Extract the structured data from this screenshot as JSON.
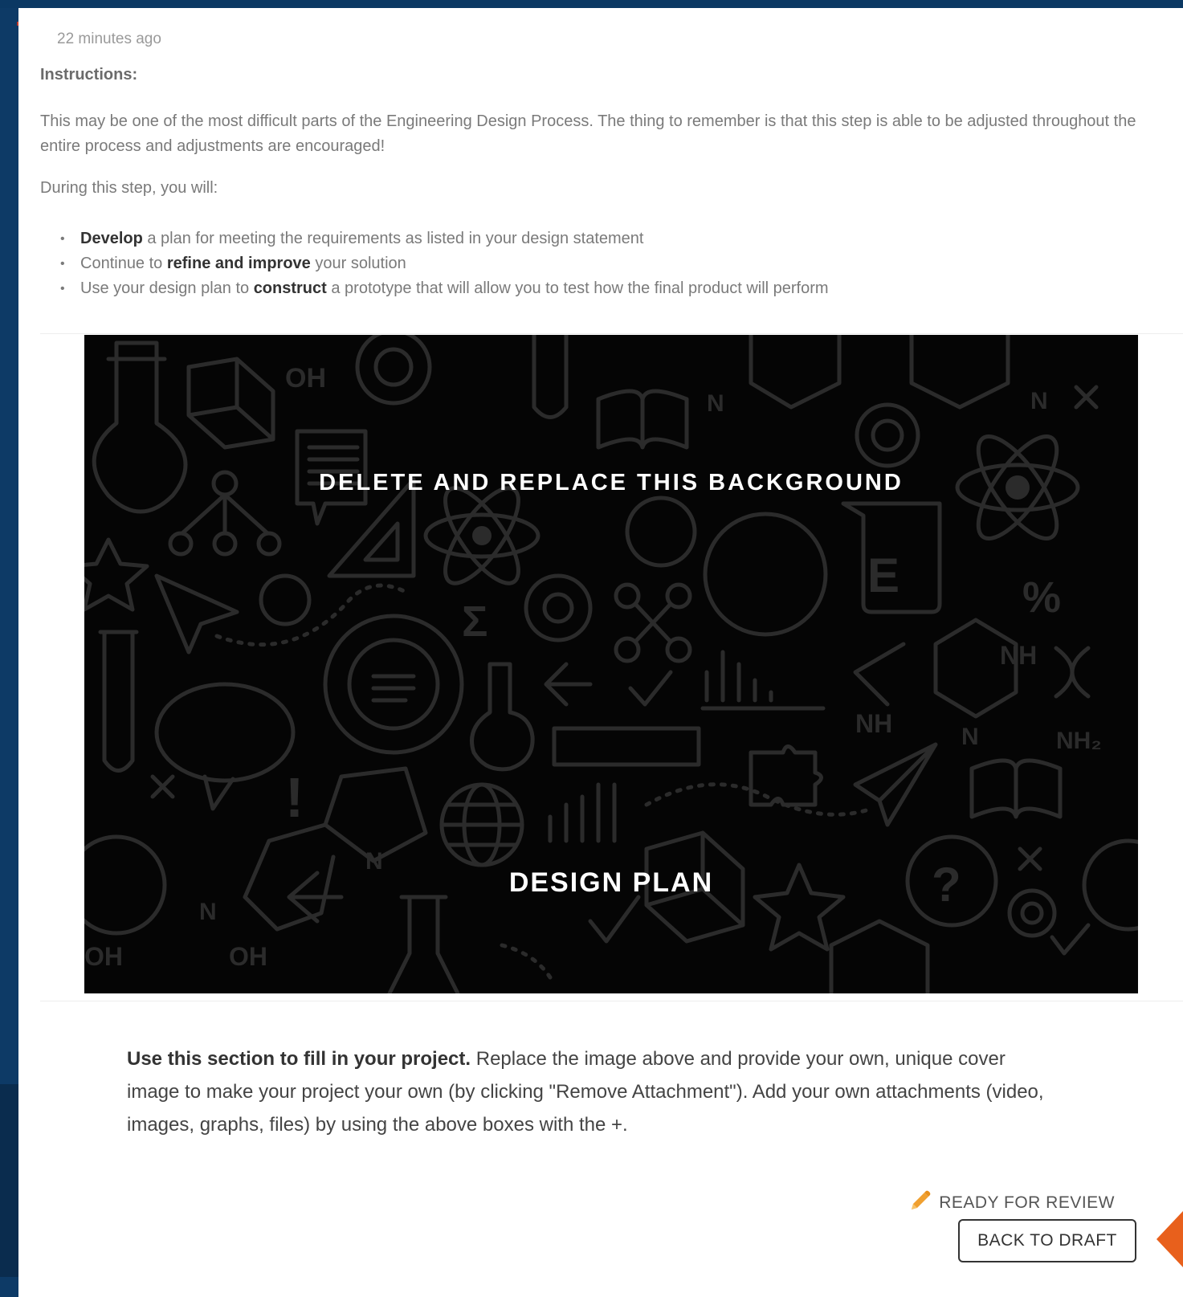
{
  "post": {
    "timestamp": "22 minutes ago",
    "instructions_label": "Instructions:",
    "paragraph": "This may be one of the most difficult parts of the Engineering Design Process. The thing to remember is that this step is able to be adjusted throughout the entire process and adjustments are encouraged!",
    "during_label": "During this step, you will:",
    "bullets": [
      {
        "pre": "",
        "bold": "Develop",
        "post": " a plan for meeting the requirements as listed in your design statement"
      },
      {
        "pre": "Continue to ",
        "bold": "refine and improve",
        "post": " your solution"
      },
      {
        "pre": "Use your design plan to ",
        "bold": "construct",
        "post": " a prototype that will allow you to test how the final product will perform"
      }
    ]
  },
  "cover_image": {
    "headline": "DELETE AND REPLACE THIS BACKGROUND",
    "subtitle": "DESIGN PLAN",
    "background_color": "#050505",
    "icon_color": "#2b2b2b",
    "doodle_labels": [
      "OH",
      "N",
      "N",
      "NH",
      "NH",
      "N",
      "NH₂",
      "N",
      "OH",
      "OH",
      "N",
      "E",
      "Σ",
      "?",
      "%",
      "!"
    ]
  },
  "note": {
    "bold": "Use this section to fill in your project.",
    "text": " Replace the image above and provide your own, unique cover image to make your project your own (by clicking \"Remove Attachment\"). Add your own attachments (video, images, graphs, files) by using the above boxes with the +."
  },
  "actions": {
    "status_label": "READY FOR REVIEW",
    "status_icon": "pencil-icon",
    "back_to_draft": "BACK TO DRAFT"
  },
  "colors": {
    "accent_orange": "#f0a030",
    "arrow_orange": "#e8601c",
    "frame_blue": "#0d3a66"
  }
}
